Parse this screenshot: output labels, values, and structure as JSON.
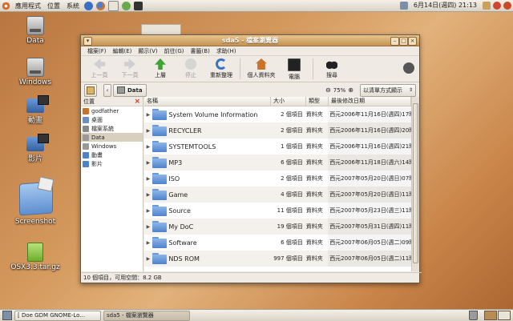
{
  "top_panel": {
    "menus": [
      "應用程式",
      "位置",
      "系統"
    ],
    "clock": "6月14日(週四) 21:13"
  },
  "desktop": {
    "icons": [
      {
        "label": "Data"
      },
      {
        "label": "Windows"
      },
      {
        "label": "動畫"
      },
      {
        "label": "影片"
      },
      {
        "label": "Screenshot"
      },
      {
        "label": "OSX3.3.tar.gz"
      }
    ]
  },
  "window": {
    "title": "sda5 - 檔案瀏覽器",
    "menubar": [
      "檔案(F)",
      "編輯(E)",
      "顯示(V)",
      "前往(G)",
      "書籤(B)",
      "求助(H)"
    ],
    "toolbar": {
      "back": "上一頁",
      "forward": "下一頁",
      "up": "上層",
      "stop": "停止",
      "reload": "重新整理",
      "home": "個人資料夾",
      "computer": "電腦",
      "search": "搜尋"
    },
    "location": {
      "path_button": "Data",
      "zoom": "75%",
      "view_mode": "以清單方式顯示"
    },
    "sidebar": {
      "header": "位置",
      "items": [
        "godfather",
        "桌面",
        "檔案系統",
        "Data",
        "Windows",
        "動畫",
        "影片"
      ],
      "selected": "Data"
    },
    "columns": [
      "名稱",
      "大小",
      "類型",
      "最後修改日期"
    ],
    "rows": [
      {
        "name": "System Volume Information",
        "size": "2 個項目",
        "type": "資料夾",
        "date": "西元2006年11月16日(週四)17時"
      },
      {
        "name": "RECYCLER",
        "size": "2 個項目",
        "type": "資料夾",
        "date": "西元2006年11月16日(週四)20時"
      },
      {
        "name": "SYSTEMTOOLS",
        "size": "1 個項目",
        "type": "資料夾",
        "date": "西元2006年11月16日(週四)21時"
      },
      {
        "name": "MP3",
        "size": "6 個項目",
        "type": "資料夾",
        "date": "西元2006年11月18日(週六)14時"
      },
      {
        "name": "ISO",
        "size": "2 個項目",
        "type": "資料夾",
        "date": "西元2007年05月20日(週日)07時"
      },
      {
        "name": "Game",
        "size": "4 個項目",
        "type": "資料夾",
        "date": "西元2007年05月20日(週日)11時"
      },
      {
        "name": "Source",
        "size": "11 個項目",
        "type": "資料夾",
        "date": "西元2007年05月23日(週三)11時"
      },
      {
        "name": "My DoC",
        "size": "19 個項目",
        "type": "資料夾",
        "date": "西元2007年05月31日(週四)11時"
      },
      {
        "name": "Software",
        "size": "6 個項目",
        "type": "資料夾",
        "date": "西元2007年06月05日(週二)09時"
      },
      {
        "name": "NDS ROM",
        "size": "997 個項目",
        "type": "資料夾",
        "date": "西元2007年06月05日(週二)11時"
      }
    ],
    "status": "10 個項目，可用空間：8.2 GB"
  },
  "bottom_panel": {
    "tasks": [
      "[ Doe GDM GNOME-Lo...",
      "sda5 - 檔案瀏覽器"
    ]
  }
}
